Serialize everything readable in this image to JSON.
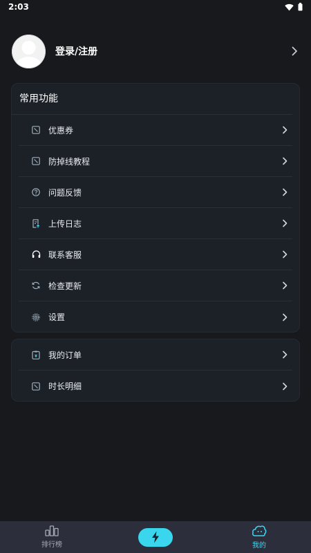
{
  "status_bar": {
    "time": "2:03",
    "icons": [
      "wifi-icon",
      "battery-icon"
    ]
  },
  "profile": {
    "name": "登录/注册",
    "avatar_icon": "default-avatar-icon"
  },
  "common_functions": {
    "title": "常用功能",
    "items": [
      {
        "label": "优惠券",
        "icon": "coupon-icon"
      },
      {
        "label": "防掉线教程",
        "icon": "tutorial-icon"
      },
      {
        "label": "问题反馈",
        "icon": "help-circle-icon"
      },
      {
        "label": "上传日志",
        "icon": "upload-log-icon"
      },
      {
        "label": "联系客服",
        "icon": "headset-icon"
      },
      {
        "label": "检查更新",
        "icon": "refresh-icon"
      },
      {
        "label": "设置",
        "icon": "gear-icon"
      }
    ]
  },
  "account": {
    "items": [
      {
        "label": "我的订单",
        "icon": "order-icon"
      },
      {
        "label": "时长明细",
        "icon": "duration-icon"
      }
    ]
  },
  "bottom_nav": {
    "items": [
      {
        "label": "排行榜",
        "icon": "ranking-icon",
        "active": false
      },
      {
        "label": "",
        "icon": "lightning-icon",
        "active": false
      },
      {
        "label": "我的",
        "icon": "profile-cloud-icon",
        "active": true
      }
    ]
  },
  "colors": {
    "background": "#17191d",
    "card": "#1c2128",
    "accent": "#3ad6ee",
    "icon": "#9fb0bd",
    "nav_bar": "#2c2f3b"
  }
}
